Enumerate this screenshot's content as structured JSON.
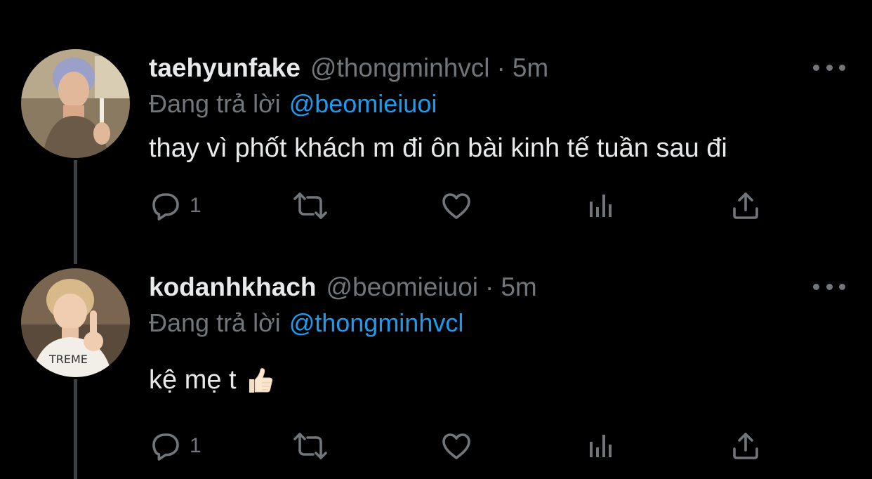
{
  "tweets": [
    {
      "display_name": "taehyunfake",
      "handle": "@thongminhvcl",
      "separator": "·",
      "time": "5m",
      "replying_label": "Đang trả lời",
      "replying_to": "@beomieiuoi",
      "text": "thay vì phốt khách m đi ôn bài kinh tế tuần sau đi",
      "emoji": "",
      "reply_count": "1",
      "avatar_icon": "avatar-photo"
    },
    {
      "display_name": "kodanhkhach",
      "handle": "@beomieiuoi",
      "separator": "·",
      "time": "5m",
      "replying_label": "Đang trả lời",
      "replying_to": "@thongminhvcl",
      "text": "kệ mẹ t",
      "emoji": "thumbs-up-icon",
      "reply_count": "1",
      "avatar_icon": "avatar-photo"
    }
  ],
  "colors": {
    "background": "#000000",
    "primary_text": "#e7e9ea",
    "secondary_text": "#71767b",
    "mention": "#1d9bf0",
    "thread_line": "#3e4144"
  },
  "icons": [
    "reply-icon",
    "retweet-icon",
    "like-icon",
    "analytics-icon",
    "share-icon",
    "more-options-icon"
  ]
}
